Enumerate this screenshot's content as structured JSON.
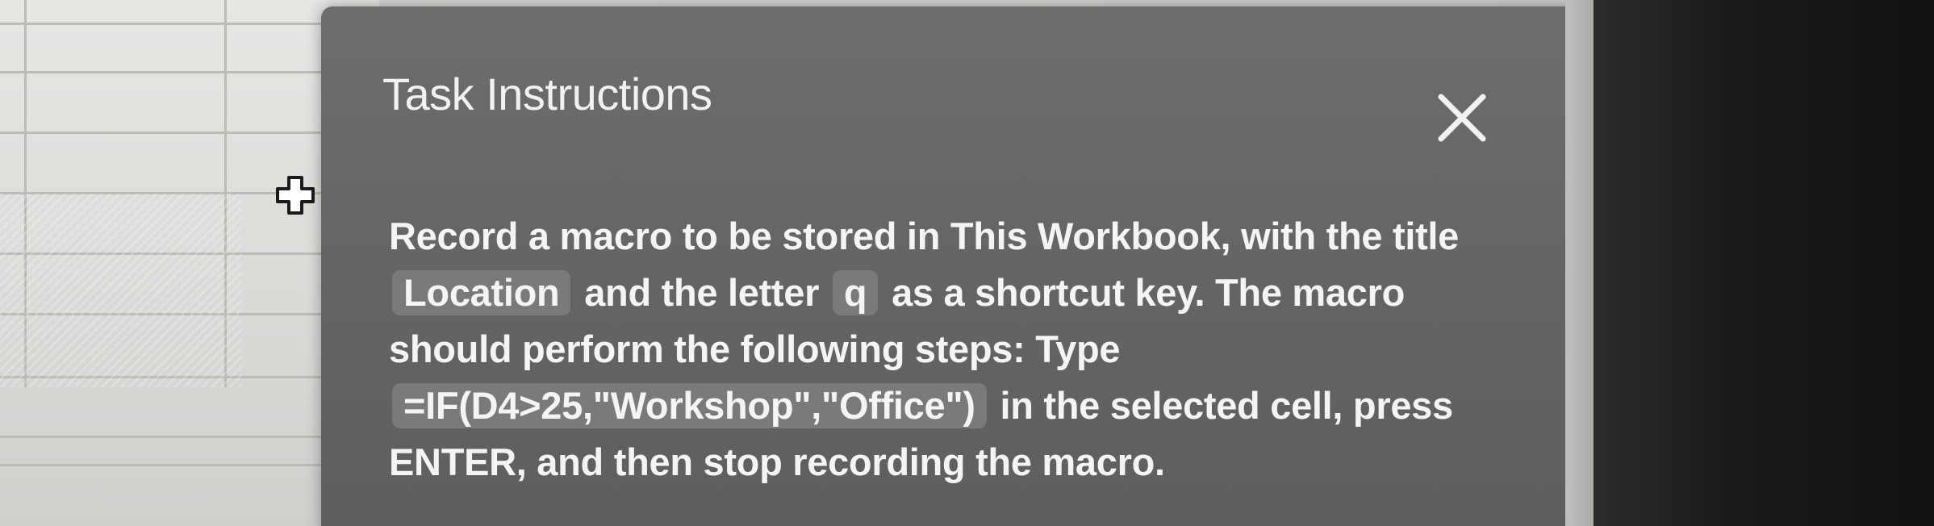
{
  "dialog": {
    "title": "Task Instructions",
    "close_icon": "close-x-icon",
    "instructions": {
      "part1": "Record a macro to be stored in This Workbook, with the title",
      "macro_name": "Location",
      "part2": "and the letter",
      "shortcut_key": "q",
      "part3": "as a shortcut key. The macro should perform the following steps: Type",
      "formula": "=IF(D4>25,\"Workshop\",\"Office\")",
      "part4": "in the selected cell, press ENTER, and then stop recording the macro."
    }
  },
  "cursor": {
    "icon": "move-cross-cursor-icon"
  },
  "colors": {
    "dialog_bg": "#666664",
    "dialog_text": "#f4f4f2",
    "chip_bg": "#7a7a78",
    "sheet_bg": "#dcdcd9",
    "gridline": "#b9bdb6"
  }
}
